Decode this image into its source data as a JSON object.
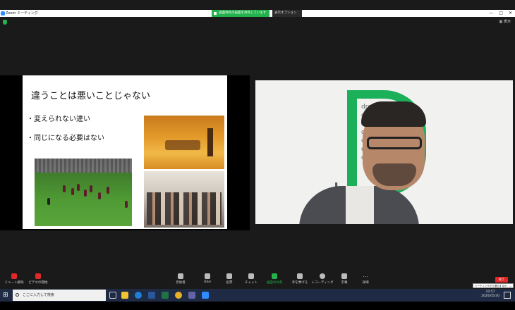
{
  "titlebar": {
    "app_title": "Zoom ミーティング",
    "share_banner": "画面共有の画面を共有しています",
    "view_options": "表示オプション",
    "controls": [
      "—",
      "□",
      "✕"
    ]
  },
  "meeting": {
    "gallery_label": "表示"
  },
  "slide": {
    "title": "違うことは悪いことじゃない",
    "bullets": [
      "・変えられない違い",
      "・同じになる必要はない"
    ]
  },
  "video": {
    "logo_words": [
      "dream",
      "disab",
      "da",
      "d",
      "d",
      "d",
      "d"
    ],
    "logo_word_be": "be    d"
  },
  "toolbar": {
    "items": [
      {
        "label": "ミュート解除",
        "icon": "mic-muted-icon"
      },
      {
        "label": "ビデオの開始",
        "icon": "video-off-icon"
      },
      {
        "label": "参加者",
        "icon": "participants-icon"
      },
      {
        "label": "Q&A",
        "icon": "qa-icon"
      },
      {
        "label": "投票",
        "icon": "poll-icon"
      },
      {
        "label": "チャット",
        "icon": "chat-icon"
      },
      {
        "label": "画面の共有",
        "icon": "share-screen-icon"
      },
      {
        "label": "手を挙げる",
        "icon": "raise-hand-icon"
      },
      {
        "label": "レコーディング",
        "icon": "record-icon"
      },
      {
        "label": "字幕",
        "icon": "cc-icon"
      },
      {
        "label": "詳細",
        "icon": "more-icon"
      }
    ],
    "end_label": "終了",
    "end_tooltip": "ミーティングから退出するか、..."
  },
  "taskbar": {
    "search_placeholder": "ここに入力して検索",
    "time": "10:57",
    "date": "2020/05/30"
  },
  "colors": {
    "zoom_green": "#23b24c",
    "end_red": "#e02828",
    "logo_green": "#1cb05a"
  }
}
